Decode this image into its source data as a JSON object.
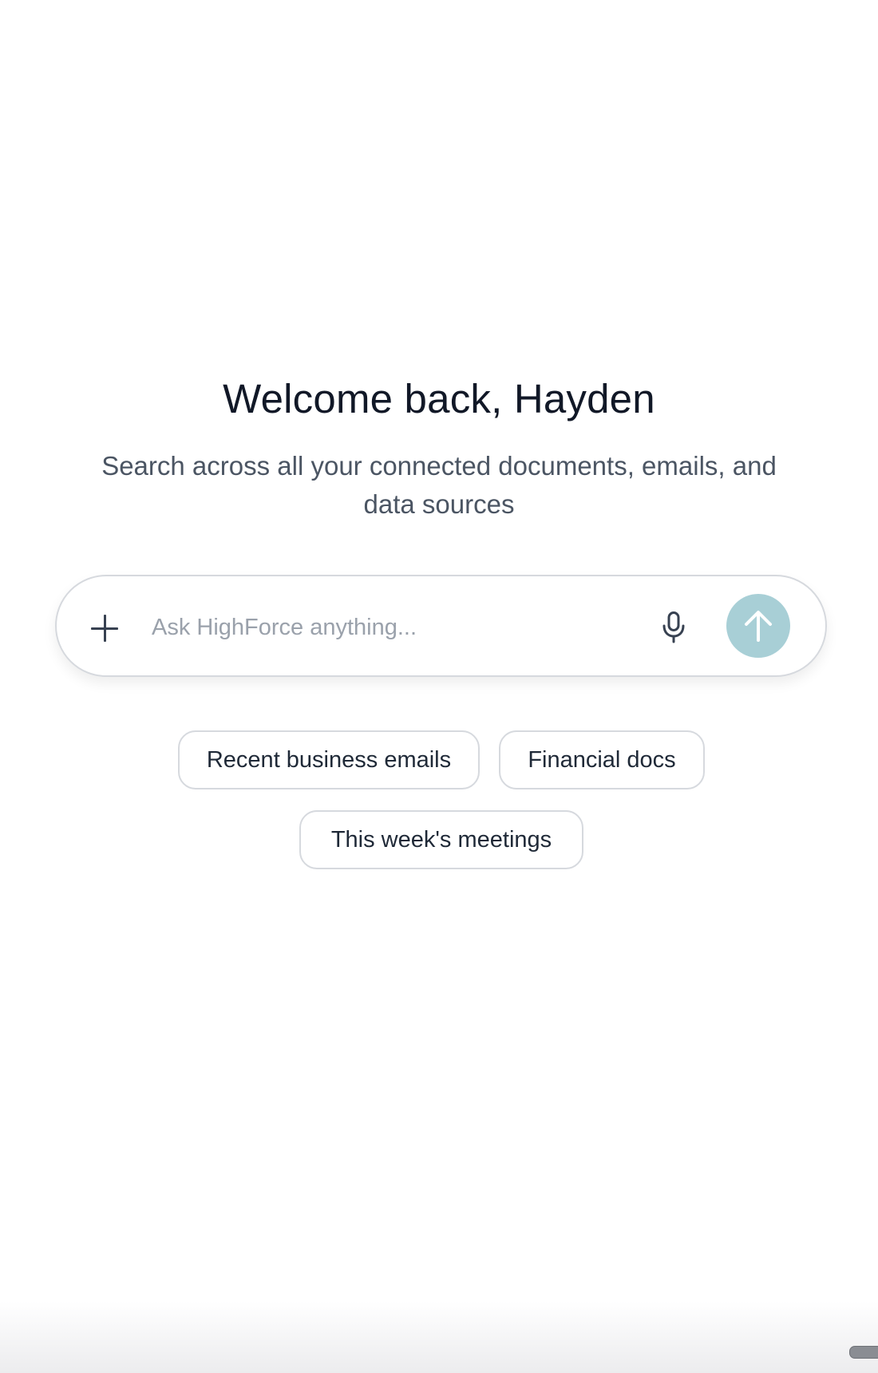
{
  "header": {
    "title": "Welcome back, Hayden",
    "subtitle": "Search across all your connected documents, emails, and data sources"
  },
  "search": {
    "placeholder": "Ask HighForce anything...",
    "value": "",
    "attach_icon": "plus-icon",
    "voice_icon": "microphone-icon",
    "send_icon": "arrow-up-icon",
    "send_button_color": "#a8cfd6"
  },
  "suggestions": [
    {
      "label": "Recent business emails"
    },
    {
      "label": "Financial docs"
    },
    {
      "label": "This week's meetings"
    }
  ]
}
